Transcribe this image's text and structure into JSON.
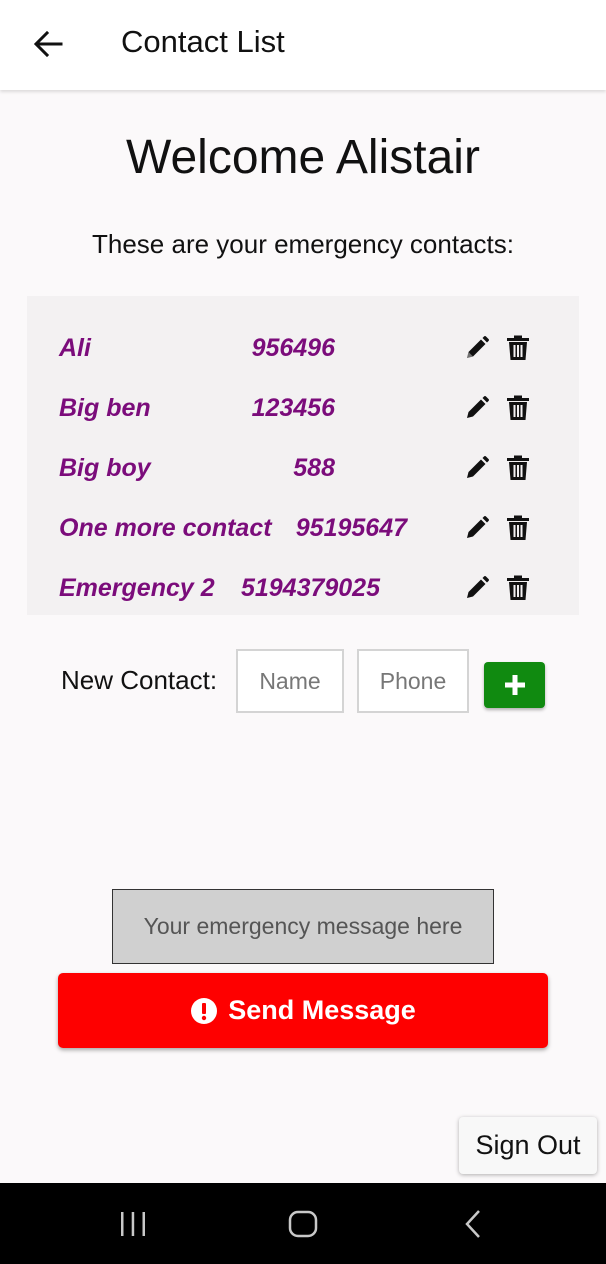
{
  "app_bar": {
    "title": "Contact List",
    "back_icon": "arrow-left-icon"
  },
  "welcome": "Welcome Alistair",
  "subtitle": "These are your emergency contacts:",
  "colors": {
    "contact_text": "#7b0c7b",
    "add_button": "#108a10",
    "send_button": "#fe0000"
  },
  "contacts": [
    {
      "name": "Ali",
      "phone": "956496"
    },
    {
      "name": "Big ben",
      "phone": "123456"
    },
    {
      "name": "Big boy",
      "phone": "588"
    },
    {
      "name": "One more contact",
      "phone": "95195647"
    },
    {
      "name": "Emergency 2",
      "phone": "5194379025"
    }
  ],
  "new_contact": {
    "label": "New Contact:",
    "name_placeholder": "Name",
    "phone_placeholder": "Phone",
    "add_icon": "plus-icon"
  },
  "message": {
    "placeholder": "Your emergency message here"
  },
  "send_button": {
    "label": "Send Message",
    "icon": "exclamation-circle-icon"
  },
  "sign_out": "Sign Out",
  "system_nav": {
    "recents_icon": "recents-icon",
    "home_icon": "home-icon",
    "back_icon": "back-chevron-icon"
  }
}
